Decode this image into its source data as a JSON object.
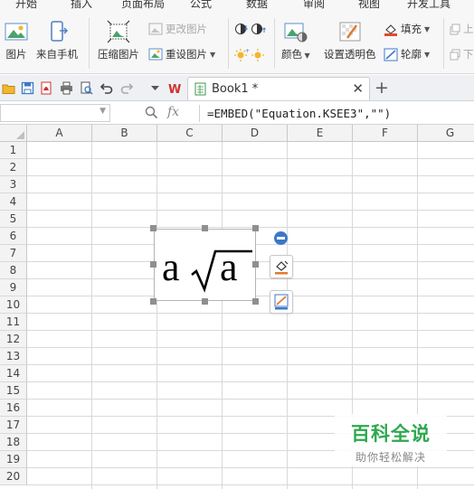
{
  "menu_tabs": [
    "开始",
    "插入",
    "页面布局",
    "公式",
    "数据",
    "审阅",
    "视图",
    "开发工具"
  ],
  "ribbon": {
    "picture_label": "图片",
    "from_phone_label": "来自手机",
    "compress_label": "压缩图片",
    "change_picture_label": "更改图片",
    "reset_picture_label": "重设图片",
    "color_label": "颜色",
    "set_transparent_label": "设置透明色",
    "fill_label": "填充",
    "outline_label": "轮廓",
    "partial_top": "上",
    "partial_bottom": "下"
  },
  "document": {
    "tab_name": "Book1 *"
  },
  "formula_bar": {
    "name_box": "",
    "fx_label": "fx",
    "formula": "=EMBED(\"Equation.KSEE3\",\"\")"
  },
  "sheet": {
    "columns": [
      "A",
      "B",
      "C",
      "D",
      "E",
      "F",
      "G"
    ],
    "rows": [
      "1",
      "2",
      "3",
      "4",
      "5",
      "6",
      "7",
      "8",
      "9",
      "10",
      "11",
      "12",
      "13",
      "14",
      "15",
      "16",
      "17",
      "18",
      "19",
      "20"
    ]
  },
  "equation": {
    "coefficient": "a",
    "radicand": "a"
  },
  "watermark": {
    "title": "百科全说",
    "subtitle": "助你轻松解决"
  },
  "colors": {
    "watermark_green": "#2fa84f",
    "accent_blue": "#3b78c8",
    "selection_handle": "#8f8f8f"
  }
}
